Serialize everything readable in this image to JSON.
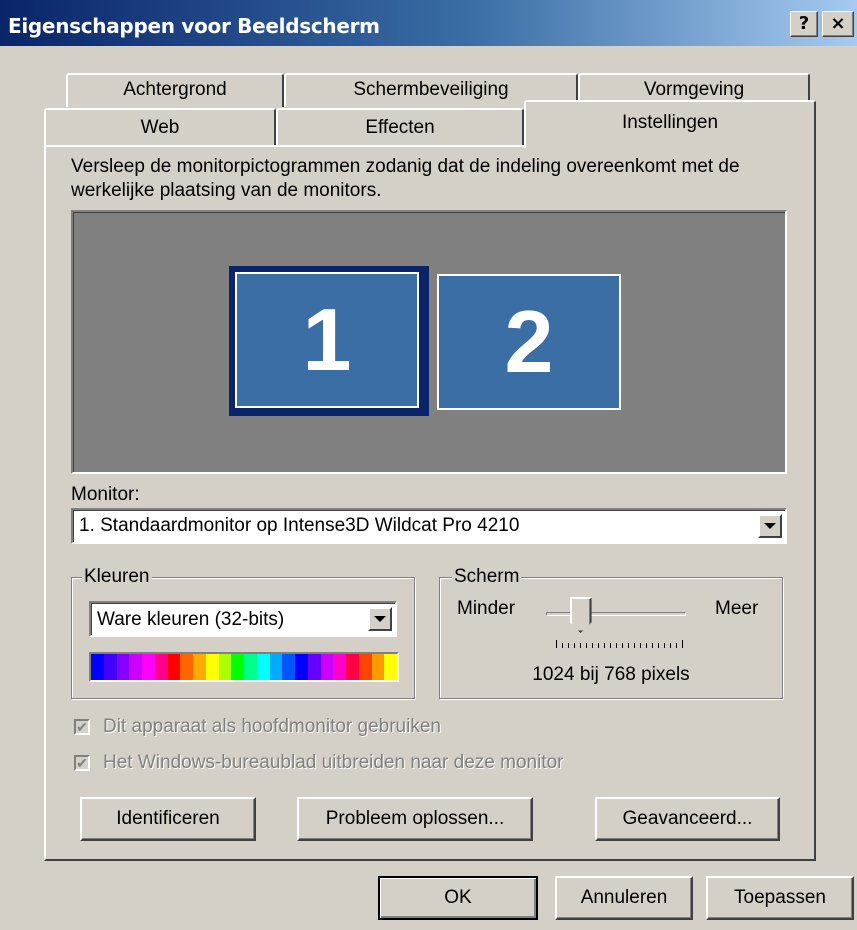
{
  "window": {
    "title": "Eigenschappen voor Beeldscherm",
    "help_label": "?",
    "close_label": "×"
  },
  "tabs": {
    "row1": [
      "Achtergrond",
      "Schermbeveiliging",
      "Vormgeving"
    ],
    "row2": [
      "Web",
      "Effecten",
      "Instellingen"
    ],
    "active": "Instellingen"
  },
  "instruction": "Versleep de monitorpictogrammen zodanig dat de indeling overeenkomt met de werkelijke plaatsing van de monitors.",
  "monitors": {
    "primary_label": "1",
    "secondary_label": "2",
    "selected": "1"
  },
  "monitor_select": {
    "label": "Monitor:",
    "value": "1. Standaardmonitor op Intense3D Wildcat Pro 4210"
  },
  "colors": {
    "legend": "Kleuren",
    "value": "Ware kleuren (32-bits)",
    "spectrum": [
      "#0000ff",
      "#4400ff",
      "#8800ff",
      "#cc00ff",
      "#ff00ff",
      "#ff0088",
      "#ff0000",
      "#ff6600",
      "#ffaa00",
      "#ffff00",
      "#aaff00",
      "#00ff00",
      "#00ff88",
      "#00ffff",
      "#00aaff",
      "#0055ff",
      "#0000ff",
      "#6600ff",
      "#cc00ff",
      "#ff00cc",
      "#ff0044",
      "#ff4400",
      "#ff9900",
      "#ffff00"
    ]
  },
  "screen": {
    "legend": "Scherm",
    "less_label": "Minder",
    "more_label": "Meer",
    "resolution": "1024 bij 768 pixels",
    "slider_position_fraction": 0.2
  },
  "checkboxes": [
    {
      "label": "Dit apparaat als hoofdmonitor gebruiken",
      "checked": true,
      "enabled": false
    },
    {
      "label": "Het Windows-bureaublad uitbreiden naar deze monitor",
      "checked": true,
      "enabled": false
    }
  ],
  "panel_buttons": {
    "identify": "Identificeren",
    "troubleshoot": "Probleem oplossen...",
    "advanced": "Geavanceerd..."
  },
  "dialog_buttons": {
    "ok": "OK",
    "cancel": "Annuleren",
    "apply": "Toepassen"
  }
}
